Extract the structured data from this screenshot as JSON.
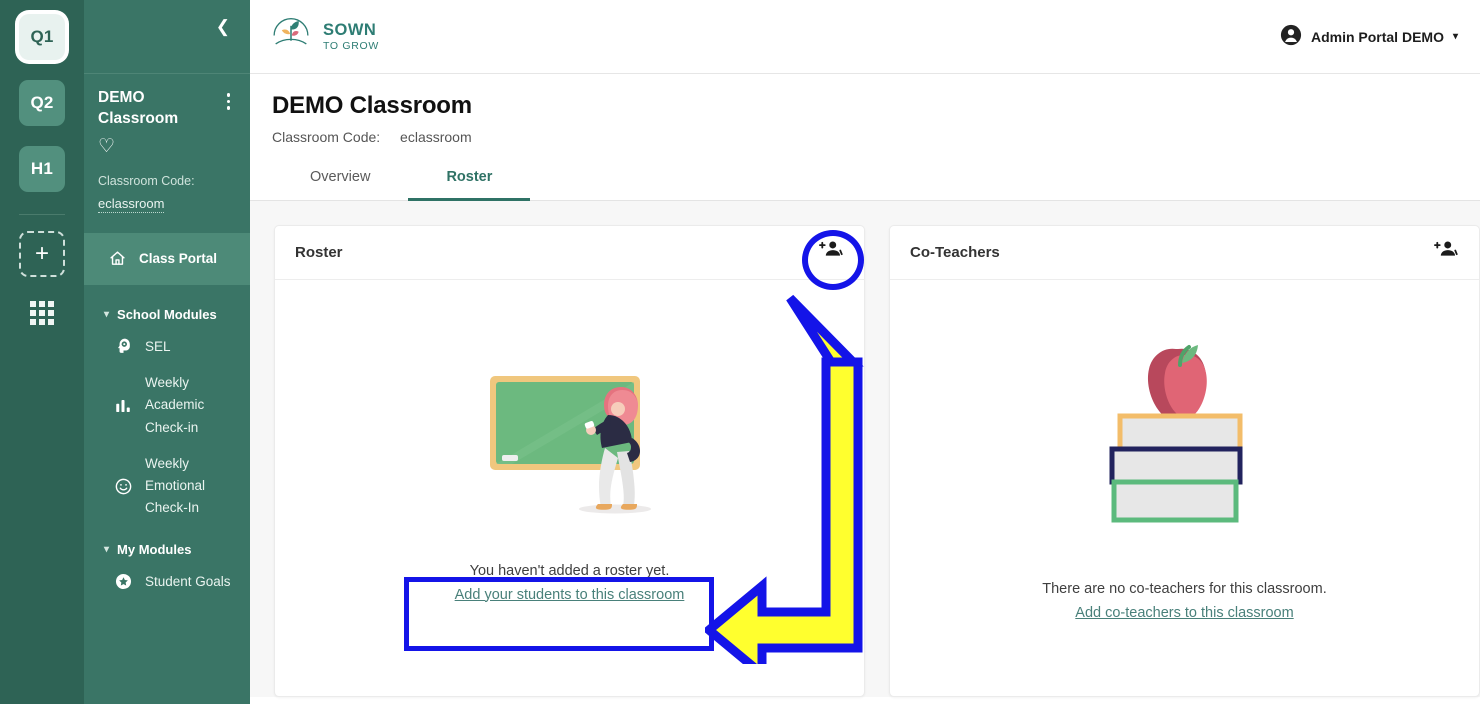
{
  "rail": {
    "terms": [
      {
        "label": "Q1",
        "active": true
      },
      {
        "label": "Q2",
        "active": false
      },
      {
        "label": "H1",
        "active": false
      }
    ],
    "add_label": "+",
    "apps_icon": "grid-apps-icon"
  },
  "sidebar": {
    "collapse_icon": "chevron-left-icon",
    "classroom_name": "DEMO Classroom",
    "kebab_icon": "kebab-menu-icon",
    "favorite_icon": "heart-icon",
    "code_label": "Classroom Code:",
    "code_value": "eclassroom",
    "portal_item": {
      "label": "Class Portal",
      "icon": "home-icon"
    },
    "groups": [
      {
        "label": "School Modules",
        "caret": "chevron-down-icon",
        "items": [
          {
            "label": "SEL",
            "icon": "brain-head-icon"
          },
          {
            "label": "Weekly Academic Check-in",
            "icon": "bar-chart-icon"
          },
          {
            "label": "Weekly Emotional Check-In",
            "icon": "smiley-face-icon"
          }
        ]
      },
      {
        "label": "My Modules",
        "caret": "chevron-down-icon",
        "items": [
          {
            "label": "Student Goals",
            "icon": "star-circle-icon"
          }
        ]
      }
    ]
  },
  "topbar": {
    "logo_line1": "SOWN",
    "logo_line2": "TO GROW",
    "logo_icon": "sown-to-grow-sprout-logo",
    "account_icon": "user-avatar-icon",
    "account_label": "Admin Portal DEMO",
    "account_caret": "chevron-down-icon"
  },
  "page": {
    "title": "DEMO Classroom",
    "code_label": "Classroom Code:",
    "code_value": "eclassroom",
    "tabs": [
      {
        "label": "Overview",
        "active": false
      },
      {
        "label": "Roster",
        "active": true
      }
    ]
  },
  "roster_card": {
    "title": "Roster",
    "add_icon": "add-people-icon",
    "illustration": "teacher-at-chalkboard-illustration",
    "empty_text": "You haven't added a roster yet.",
    "empty_link": "Add your students to this classroom"
  },
  "coteachers_card": {
    "title": "Co-Teachers",
    "add_icon": "add-people-icon",
    "illustration": "apple-on-books-illustration",
    "empty_text": "There are no co-teachers for this classroom.",
    "empty_link": "Add co-teachers to this classroom"
  },
  "annotations": {
    "circle": "highlight-circle-add-students-icon",
    "arrow": "yellow-elbow-arrow",
    "box": "highlight-box-empty-roster-message",
    "outline_color": "#1414e8",
    "fill_color": "#ffff2e"
  },
  "colors": {
    "rail_bg": "#2e6355",
    "sidebar_bg": "#3a7566",
    "accent_teal": "#2f7265",
    "link_teal": "#49807a"
  }
}
